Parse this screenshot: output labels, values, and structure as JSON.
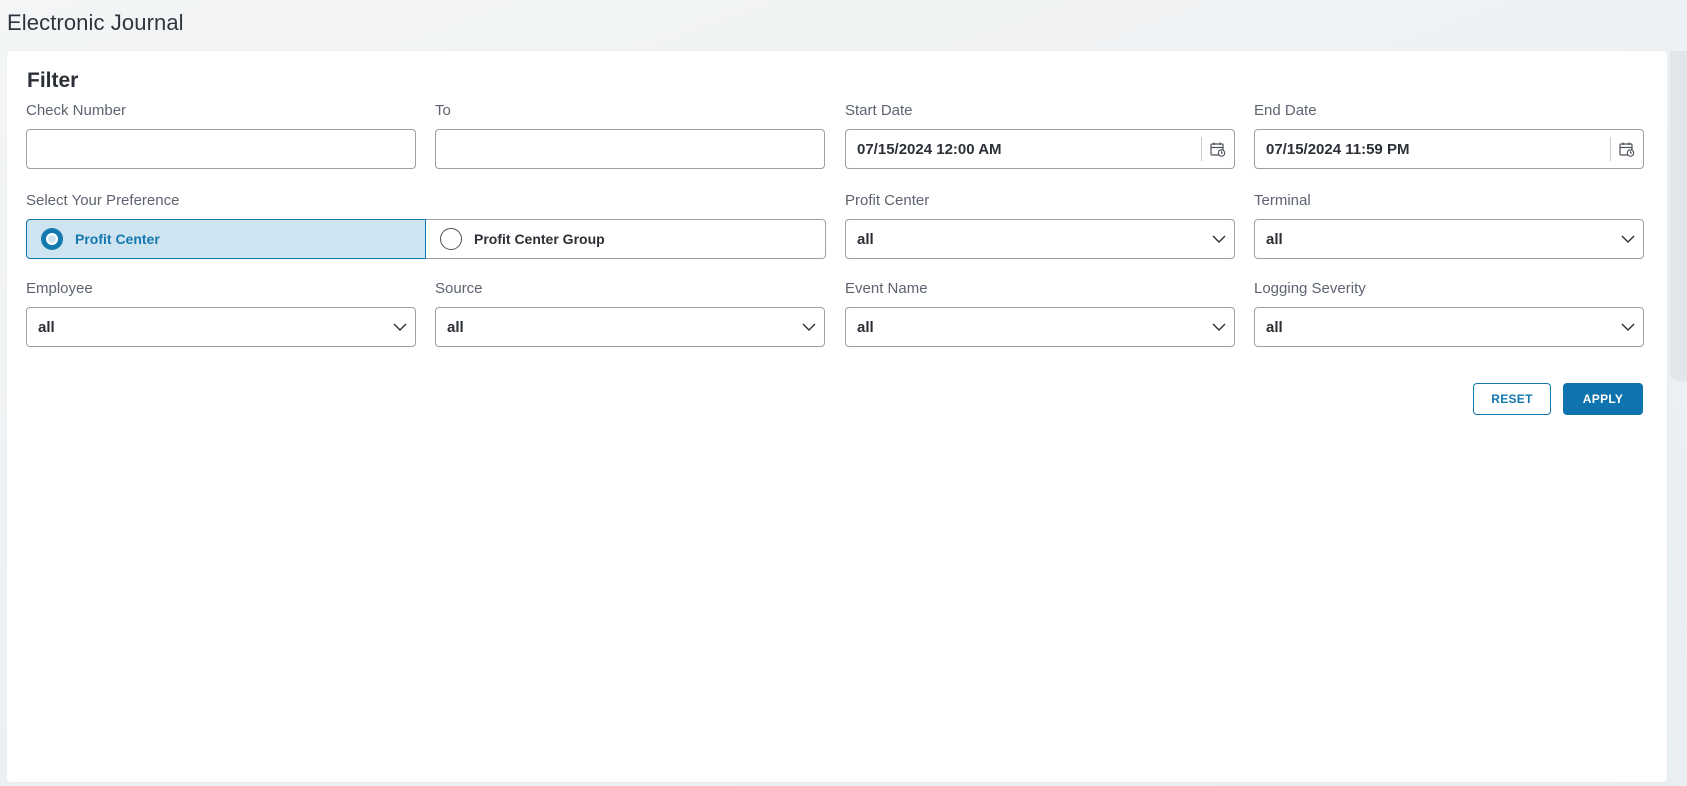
{
  "page": {
    "title": "Electronic Journal"
  },
  "filter": {
    "title": "Filter",
    "check_number": {
      "label": "Check Number",
      "value": "",
      "placeholder": ""
    },
    "to": {
      "label": "To",
      "value": "",
      "placeholder": ""
    },
    "start_date": {
      "label": "Start Date",
      "value": "07/15/2024 12:00 AM"
    },
    "end_date": {
      "label": "End Date",
      "value": "07/15/2024 11:59 PM"
    },
    "preference": {
      "label": "Select Your Preference",
      "options": [
        {
          "label": "Profit Center",
          "selected": true
        },
        {
          "label": "Profit Center Group",
          "selected": false
        }
      ]
    },
    "profit_center": {
      "label": "Profit Center",
      "value": "all"
    },
    "terminal": {
      "label": "Terminal",
      "value": "all"
    },
    "employee": {
      "label": "Employee",
      "value": "all"
    },
    "source": {
      "label": "Source",
      "value": "all"
    },
    "event_name": {
      "label": "Event Name",
      "value": "all"
    },
    "logging_severity": {
      "label": "Logging Severity",
      "value": "all"
    },
    "buttons": {
      "reset": "RESET",
      "apply": "APPLY"
    }
  },
  "colors": {
    "accent": "#1479b0",
    "selected_bg": "#cfe4f1",
    "border": "#9aa0a7"
  },
  "icons": {
    "calendar": "calendar-icon",
    "chevron": "chevron-down-icon",
    "radio_on": "radio-selected-icon",
    "radio_off": "radio-unselected-icon"
  }
}
